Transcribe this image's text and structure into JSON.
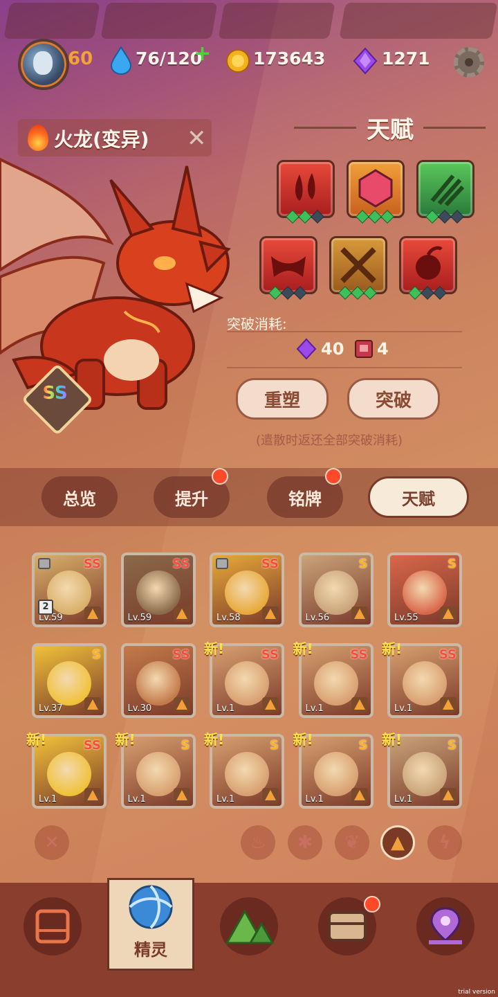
{
  "top_bar": {
    "player_level": "60",
    "energy": "76/120",
    "gold": "173643",
    "gems": "1271"
  },
  "pet": {
    "name": "火龙(变异)",
    "rank": "SS"
  },
  "talent": {
    "title": "天赋",
    "breakthrough_cost_label": "突破消耗:",
    "cost_gems": "40",
    "cost_books": "4",
    "reset_label": "重塑",
    "breakthrough_label": "突破",
    "note": "(遣散时返还全部突破消耗)",
    "tiles": [
      {
        "icon": "drops-icon",
        "pips": [
          1,
          1,
          0
        ]
      },
      {
        "icon": "gem-shield-icon",
        "pips": [
          1,
          1,
          1
        ]
      },
      {
        "icon": "claw-icon",
        "pips": [
          1,
          0,
          0
        ]
      },
      {
        "icon": "fang-icon",
        "pips": [
          1,
          0,
          0
        ]
      },
      {
        "icon": "cross-blade-icon",
        "pips": [
          1,
          1,
          1
        ]
      },
      {
        "icon": "fire-fruit-icon",
        "pips": [
          1,
          0,
          0
        ]
      }
    ]
  },
  "tabs": [
    {
      "label": "总览",
      "active": false,
      "badge": false
    },
    {
      "label": "提升",
      "active": false,
      "badge": true
    },
    {
      "label": "铭牌",
      "active": false,
      "badge": true
    },
    {
      "label": "天赋",
      "active": true,
      "badge": false
    }
  ],
  "pets": [
    {
      "rank": "SS",
      "level": "Lv.59",
      "locked": true,
      "new": false,
      "stack": "2",
      "color": "#d9b06a"
    },
    {
      "rank": "SS",
      "level": "Lv.59",
      "locked": false,
      "new": false,
      "stack": "",
      "color": "#8a6a4a"
    },
    {
      "rank": "SS",
      "level": "Lv.58",
      "locked": true,
      "new": false,
      "stack": "",
      "color": "#e8a93a"
    },
    {
      "rank": "S",
      "level": "Lv.56",
      "locked": false,
      "new": false,
      "stack": "",
      "color": "#c9a47a"
    },
    {
      "rank": "S",
      "level": "Lv.55",
      "locked": false,
      "new": false,
      "stack": "",
      "color": "#d9674a"
    },
    {
      "rank": "S",
      "level": "Lv.37",
      "locked": false,
      "new": false,
      "stack": "",
      "color": "#f0c23a"
    },
    {
      "rank": "SS",
      "level": "Lv.30",
      "locked": false,
      "new": false,
      "stack": "",
      "color": "#c47a4a"
    },
    {
      "rank": "SS",
      "level": "Lv.1",
      "locked": false,
      "new": true,
      "stack": "",
      "color": "#d8a070"
    },
    {
      "rank": "SS",
      "level": "Lv.1",
      "locked": false,
      "new": true,
      "stack": "",
      "color": "#d8a070"
    },
    {
      "rank": "SS",
      "level": "Lv.1",
      "locked": false,
      "new": true,
      "stack": "",
      "color": "#d8a070"
    },
    {
      "rank": "SS",
      "level": "Lv.1",
      "locked": false,
      "new": true,
      "stack": "",
      "color": "#f0c23a"
    },
    {
      "rank": "S",
      "level": "Lv.1",
      "locked": false,
      "new": true,
      "stack": "",
      "color": "#d8a070"
    },
    {
      "rank": "S",
      "level": "Lv.1",
      "locked": false,
      "new": true,
      "stack": "",
      "color": "#d8a070"
    },
    {
      "rank": "S",
      "level": "Lv.1",
      "locked": false,
      "new": true,
      "stack": "",
      "color": "#d8a070"
    },
    {
      "rank": "S",
      "level": "Lv.1",
      "locked": false,
      "new": true,
      "stack": "",
      "color": "#c9a47a"
    }
  ],
  "new_label": "新!",
  "filters": [
    {
      "icon": "close-icon",
      "active": false
    },
    {
      "icon": "fire-icon",
      "active": false
    },
    {
      "icon": "snowflake-icon",
      "active": false
    },
    {
      "icon": "leaf-icon",
      "active": false
    },
    {
      "icon": "mountain-icon",
      "active": true
    },
    {
      "icon": "lightning-icon",
      "active": false
    }
  ],
  "bottom_nav": {
    "selected_label": "精灵",
    "items": [
      "screen-icon",
      "sprite-icon",
      "mountain-icon",
      "chest-icon",
      "map-pin-icon"
    ]
  },
  "watermark": "trial version"
}
